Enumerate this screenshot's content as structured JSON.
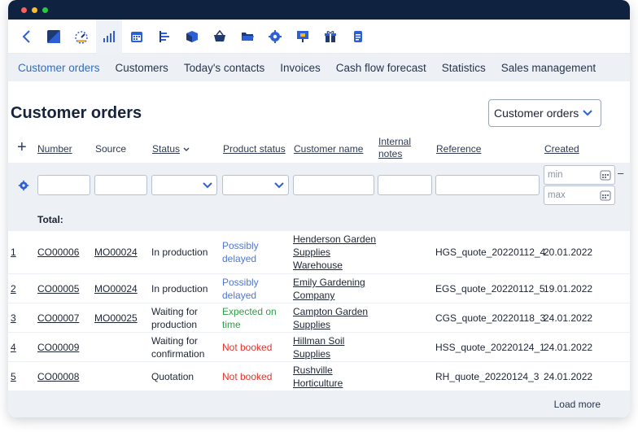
{
  "window": {
    "traffic_lights": {
      "close": "#ff5f57",
      "minimize": "#febc2e",
      "zoom": "#28c840"
    },
    "titlebar_color": "#0f2341"
  },
  "toolbar": {
    "icons": [
      "back-icon",
      "customer-orders-icon",
      "dashboard-icon",
      "statistics-icon",
      "calendar-icon",
      "planning-icon",
      "box-icon",
      "basket-icon",
      "folder-icon",
      "settings-icon",
      "presentation-icon",
      "gift-icon",
      "document-icon"
    ],
    "accent": "#2d5fd6"
  },
  "nav": {
    "items": [
      "Customer orders",
      "Customers",
      "Today's contacts",
      "Invoices",
      "Cash flow forecast",
      "Statistics",
      "Sales management"
    ]
  },
  "page": {
    "title": "Customer orders",
    "view_select": "Customer orders"
  },
  "table": {
    "headers": {
      "number": "Number",
      "source": "Source",
      "status": "Status",
      "product_status": "Product status",
      "customer_name": "Customer name",
      "internal_notes": "Internal notes",
      "reference": "Reference",
      "created": "Created"
    },
    "filters": {
      "created_min": "min",
      "created_max": "max"
    },
    "total_label": "Total:",
    "rows": [
      {
        "index": "1",
        "number": "CO00006",
        "source": "MO00024",
        "status": "In production",
        "product_status": "Possibly delayed",
        "customer": "Henderson Garden Supplies Warehouse",
        "reference": "HGS_quote_20220112_4",
        "created": "20.01.2022"
      },
      {
        "index": "2",
        "number": "CO00005",
        "source": "MO00024",
        "status": "In production",
        "product_status": "Possibly delayed",
        "customer": "Emily Gardening Company",
        "reference": "EGS_quote_20220112_5",
        "created": "19.01.2022"
      },
      {
        "index": "3",
        "number": "CO00007",
        "source": "MO00025",
        "status": "Waiting for production",
        "product_status": "Expected on time",
        "customer": "Campton Garden Supplies",
        "reference": "CGS_quote_20220118_3",
        "created": "24.01.2022"
      },
      {
        "index": "4",
        "number": "CO00009",
        "source": "",
        "status": "Waiting for confirmation",
        "product_status": "Not booked",
        "customer": "Hillman Soil Supplies",
        "reference": "HSS_quote_20220124_1",
        "created": "24.01.2022"
      },
      {
        "index": "5",
        "number": "CO00008",
        "source": "",
        "status": "Quotation",
        "product_status": "Not booked",
        "customer": "Rushville Horticulture",
        "reference": "RH_quote_20220124_3",
        "created": "24.01.2022"
      }
    ],
    "status_colors": {
      "delayed": "#4f77cf",
      "on_time": "#2f9e45",
      "not_booked": "#e1352b"
    },
    "load_more": "Load more"
  }
}
